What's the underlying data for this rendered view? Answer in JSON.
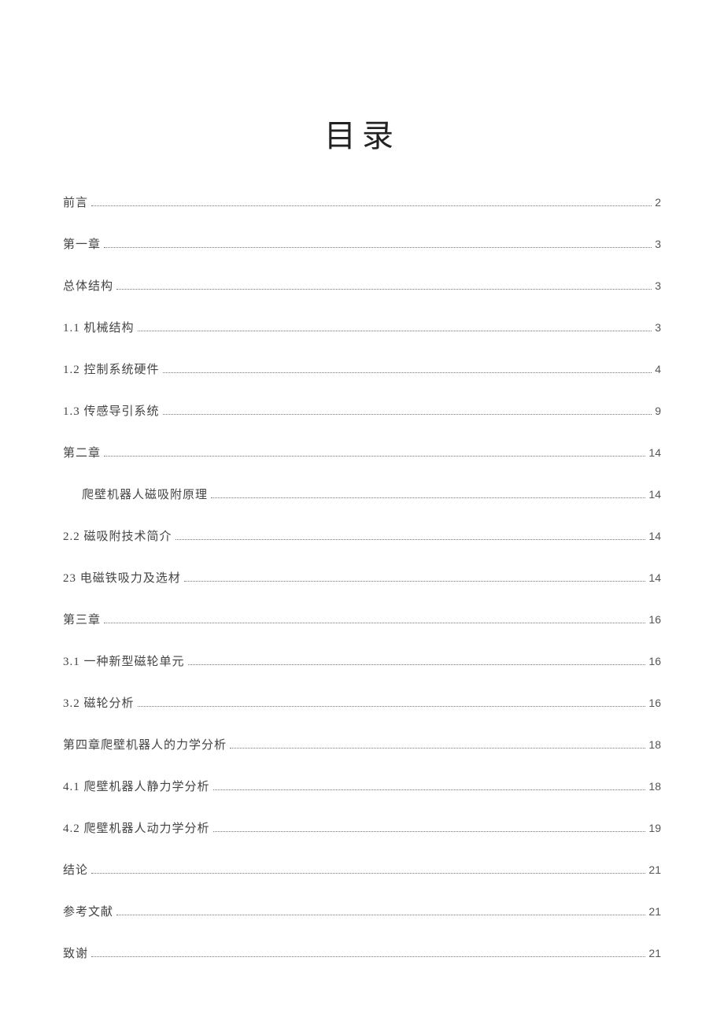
{
  "title": "目录",
  "entries": [
    {
      "label": "前言",
      "page": "2",
      "indent": false
    },
    {
      "label": "第一章",
      "page": "3",
      "indent": false
    },
    {
      "label": "总体结构",
      "page": "3",
      "indent": false
    },
    {
      "label": "1.1  机械结构",
      "page": "3",
      "indent": false
    },
    {
      "label": "1.2  控制系统硬件",
      "page": "4",
      "indent": false
    },
    {
      "label": "1.3  传感导引系统",
      "page": "9",
      "indent": false
    },
    {
      "label": "第二章",
      "page": "14",
      "indent": false
    },
    {
      "label": "爬壁机器人磁吸附原理",
      "page": "14",
      "indent": true
    },
    {
      "label": "2.2 磁吸附技术简介",
      "page": "14",
      "indent": false
    },
    {
      "label": "23 电磁铁吸力及选材",
      "page": "14",
      "indent": false
    },
    {
      "label": "第三章",
      "page": "16",
      "indent": false
    },
    {
      "label": "3.1  一种新型磁轮单元",
      "page": "16",
      "indent": false
    },
    {
      "label": "3.2  磁轮分析",
      "page": "16",
      "indent": false
    },
    {
      "label": "第四章爬壁机器人的力学分析",
      "page": "18",
      "indent": false
    },
    {
      "label": "4.1  爬壁机器人静力学分析",
      "page": "18",
      "indent": false
    },
    {
      "label": "4.2  爬壁机器人动力学分析",
      "page": "19",
      "indent": false
    },
    {
      "label": "结论",
      "page": "21",
      "indent": false
    },
    {
      "label": "参考文献",
      "page": "21",
      "indent": false
    },
    {
      "label": "致谢",
      "page": "21",
      "indent": false
    }
  ]
}
